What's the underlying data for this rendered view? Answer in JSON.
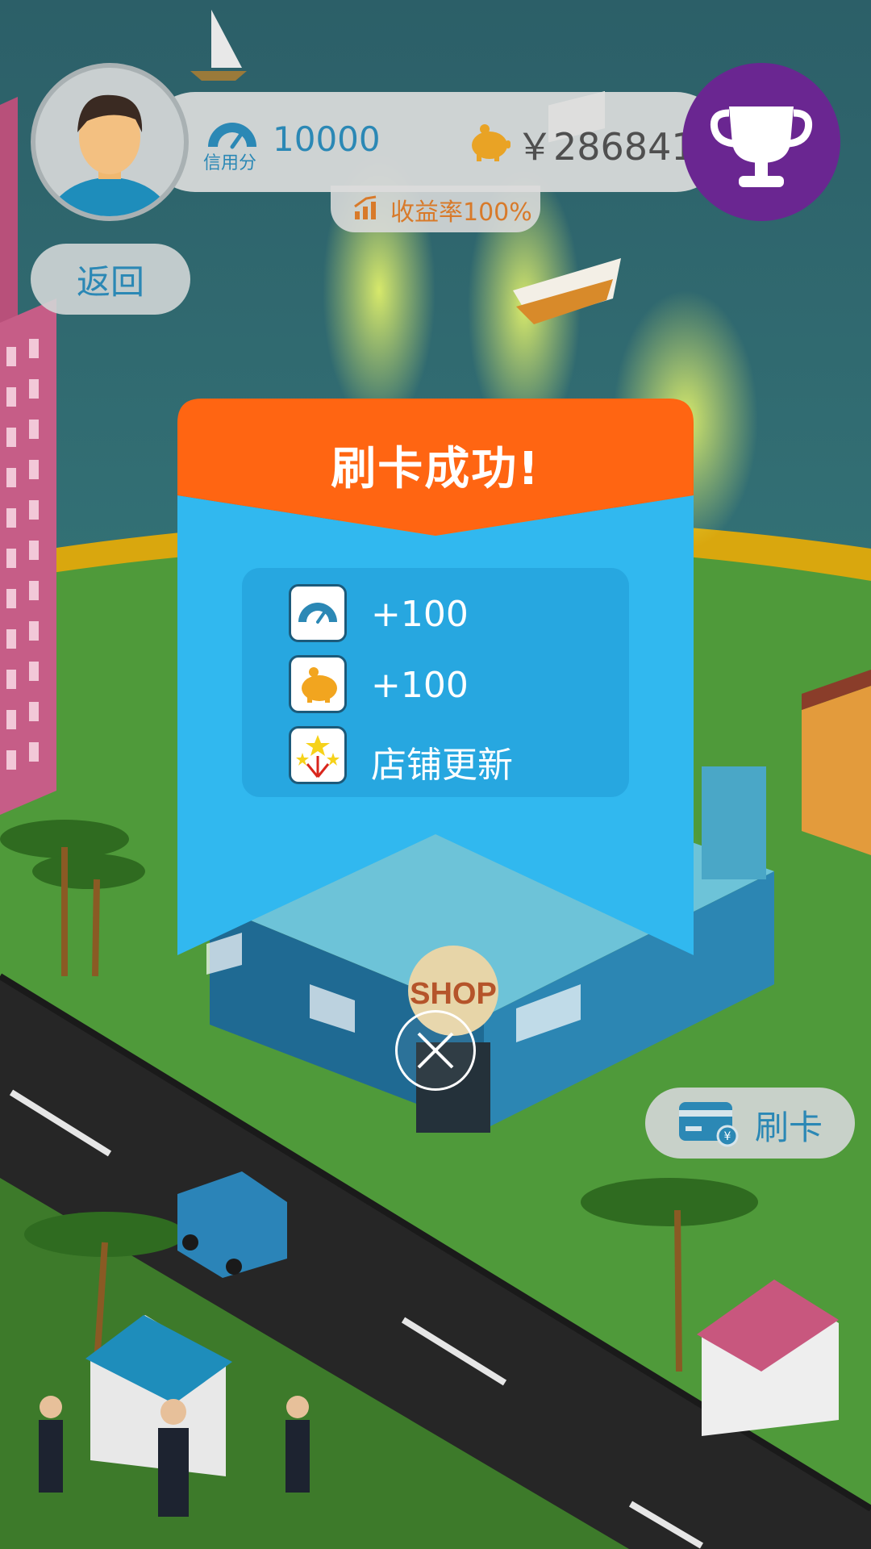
{
  "hud": {
    "credit_label": "信用分",
    "credit_value": "10000",
    "money": "￥286841",
    "yield_text": "收益率100%",
    "back_label": "返回"
  },
  "modal": {
    "title": "刷卡成功!",
    "rewards": [
      {
        "icon": "speedometer-icon",
        "text": "+100"
      },
      {
        "icon": "piggy-bank-icon",
        "text": "+100"
      },
      {
        "icon": "fireworks-icon",
        "text": "店铺更新"
      }
    ]
  },
  "scene": {
    "shop_sign": "SHOP"
  },
  "swipe_button": {
    "label": "刷卡"
  },
  "colors": {
    "accent_blue": "#2b88b5",
    "modal_blue": "#31b8ef",
    "modal_orange": "#ff6512",
    "trophy_purple": "#6a2691"
  }
}
